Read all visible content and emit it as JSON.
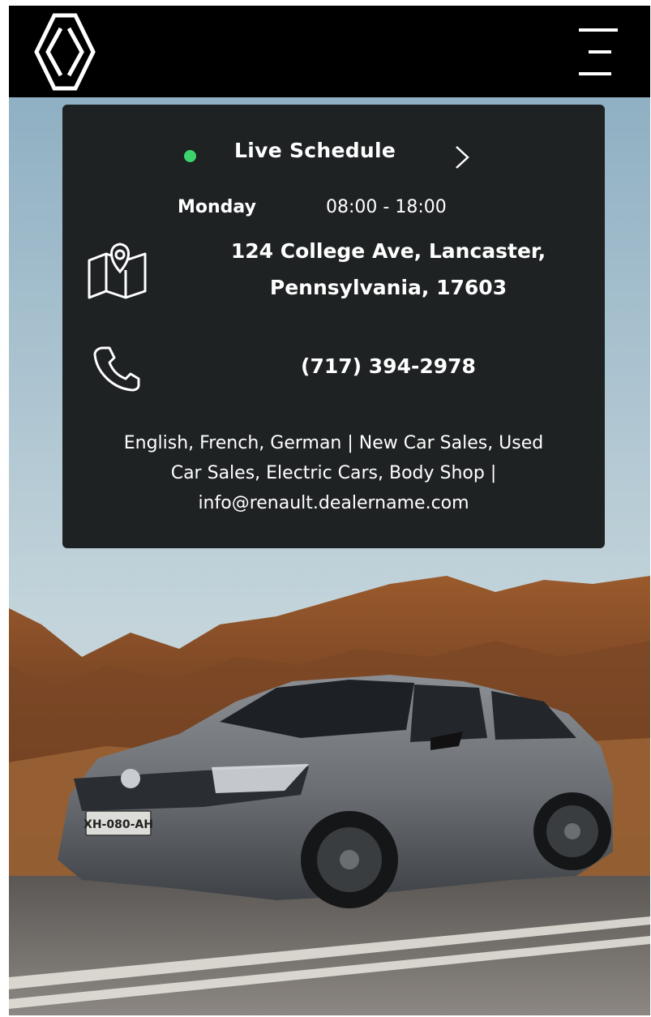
{
  "header": {
    "logo_icon": "renault-diamond-logo-icon",
    "menu_icon": "hamburger-menu-icon"
  },
  "schedule": {
    "status_color": "#3dd46e",
    "title": "Live Schedule",
    "chevron_icon": "chevron-right-icon",
    "day": "Monday",
    "hours": "08:00 - 18:00"
  },
  "location": {
    "icon": "map-pin-icon",
    "address_line1": "124 College Ave, Lancaster,",
    "address_line2": "Pennsylvania, 17603"
  },
  "contact": {
    "phone_icon": "phone-icon",
    "phone": "(717) 394-2978"
  },
  "details": {
    "line1": "English, French, German | New Car Sales, Used",
    "line2": "Car Sales, Electric Cars, Body Shop |",
    "line3": "info@renault.dealername.com"
  },
  "hero": {
    "plate": "XH-080-AH"
  }
}
